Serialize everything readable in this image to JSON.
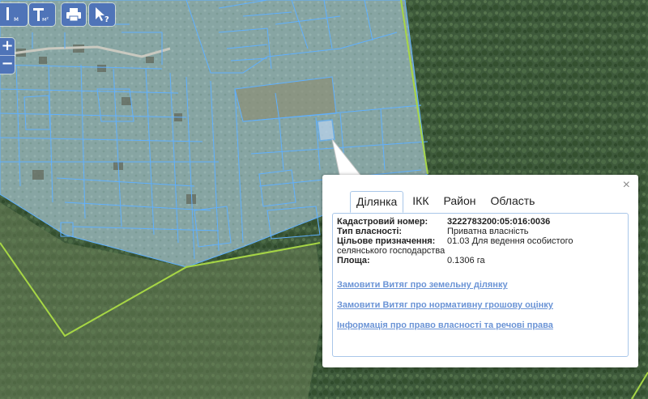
{
  "toolbar": {
    "measure_length_label": "м",
    "measure_area_label": "м²",
    "zoom_in": "+",
    "zoom_out": "−"
  },
  "popup": {
    "close": "×",
    "tabs": [
      {
        "label": "Ділянка",
        "active": true
      },
      {
        "label": "ІКК",
        "active": false
      },
      {
        "label": "Район",
        "active": false
      },
      {
        "label": "Область",
        "active": false
      }
    ],
    "fields": {
      "cadastral_label": "Кадастровий номер:",
      "cadastral_value": "3222783200:05:016:0036",
      "ownership_label": "Тип власності:",
      "ownership_value": "Приватна власність",
      "purpose_label": "Цільове призначення:",
      "purpose_value": "01.03 Для ведення особистого",
      "purpose_value_cont": "селянського господарства",
      "area_label": "Площа:",
      "area_value": "0.1306 га"
    },
    "links": [
      "Замовити Витяг про земельну ділянку",
      "Замовити Витяг про нормативну грошову оцінку",
      "Інформація про право власності та речові права"
    ]
  },
  "colors": {
    "parcel_outline": "#5fb0ff",
    "boundary_line": "#a6d645",
    "toolbar_bg": "#4f74b8",
    "link": "#6b94d6",
    "forest": "#3d5b3a"
  }
}
